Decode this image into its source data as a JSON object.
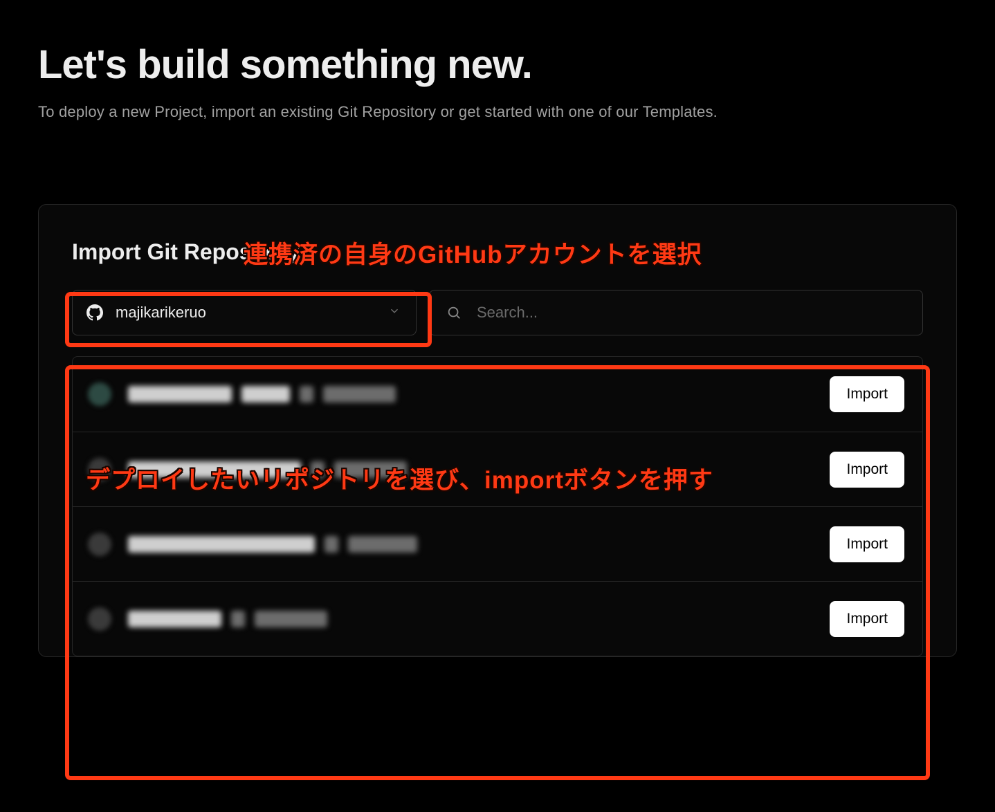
{
  "header": {
    "title": "Let's build something new.",
    "subtitle": "To deploy a new Project, import an existing Git Repository or get started with one of our Templates."
  },
  "card": {
    "title": "Import Git Repository",
    "account_selector": {
      "selected": "majikarikeruo"
    },
    "search": {
      "placeholder": "Search..."
    },
    "import_button_label": "Import",
    "repos": [
      {
        "avatar_color": "teal"
      },
      {
        "avatar_color": "gray"
      },
      {
        "avatar_color": "gray"
      },
      {
        "avatar_color": "gray"
      }
    ]
  },
  "annotations": {
    "account_note": "連携済の自身のGitHubアカウントを選択",
    "list_note": "デプロイしたいリポジトリを選び、importボタンを押す"
  },
  "colors": {
    "annotation": "#ff3914"
  }
}
